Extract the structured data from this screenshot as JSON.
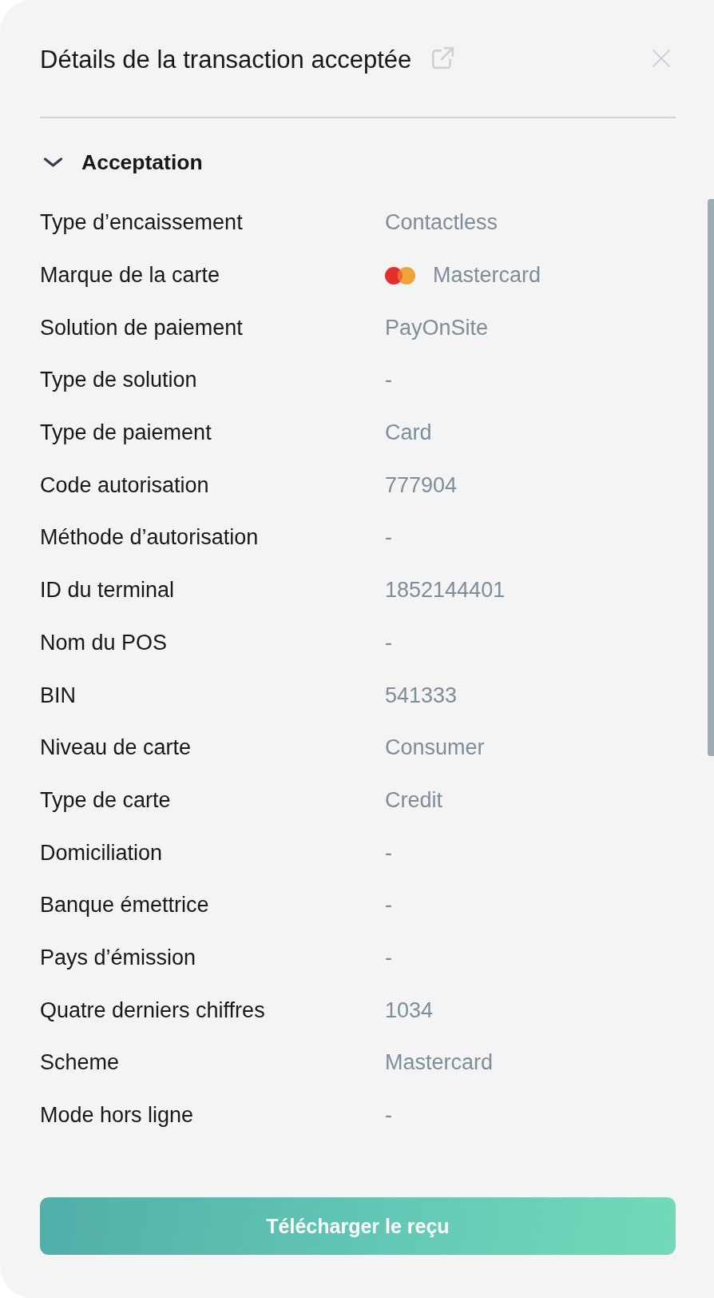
{
  "panel": {
    "title": "Détails de la transaction acceptée"
  },
  "section": {
    "title": "Acceptation",
    "expanded": true,
    "rows": [
      {
        "kind": "text",
        "label": "Type d’encaissement",
        "value": "Contactless"
      },
      {
        "kind": "brand",
        "label": "Marque de la carte",
        "value": "Mastercard"
      },
      {
        "kind": "text",
        "label": "Solution de paiement",
        "value": "PayOnSite"
      },
      {
        "kind": "text",
        "label": "Type de solution",
        "value": "-"
      },
      {
        "kind": "text",
        "label": "Type de paiement",
        "value": "Card"
      },
      {
        "kind": "text",
        "label": "Code autorisation",
        "value": "777904"
      },
      {
        "kind": "text",
        "label": "Méthode d’autorisation",
        "value": "-"
      },
      {
        "kind": "text",
        "label": "ID du terminal",
        "value": "1852144401"
      },
      {
        "kind": "text",
        "label": "Nom du POS",
        "value": "-"
      },
      {
        "kind": "text",
        "label": "BIN",
        "value": "541333"
      },
      {
        "kind": "text",
        "label": "Niveau de carte",
        "value": "Consumer"
      },
      {
        "kind": "text",
        "label": "Type de carte",
        "value": "Credit"
      },
      {
        "kind": "text",
        "label": "Domiciliation",
        "value": "-"
      },
      {
        "kind": "text",
        "label": "Banque émettrice",
        "value": "-"
      },
      {
        "kind": "text",
        "label": "Pays d’émission",
        "value": "-"
      },
      {
        "kind": "text",
        "label": "Quatre derniers chiffres",
        "value": "1034"
      },
      {
        "kind": "text",
        "label": "Scheme",
        "value": "Mastercard"
      },
      {
        "kind": "text",
        "label": "Mode hors ligne",
        "value": "-"
      }
    ]
  },
  "button": {
    "label": "Télécharger le reçu"
  }
}
